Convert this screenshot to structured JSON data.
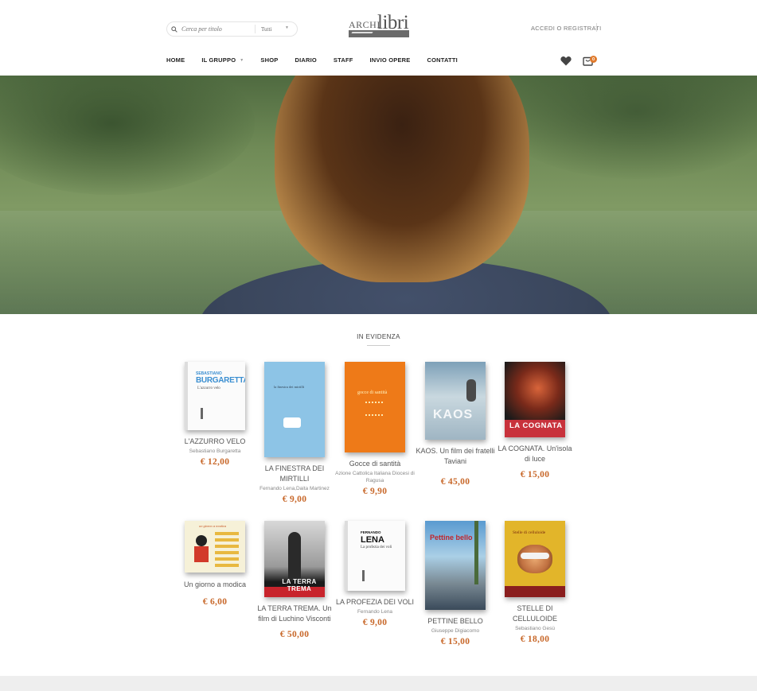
{
  "header": {
    "search": {
      "placeholder": "Cerca per titolo",
      "category": "Tutti"
    },
    "logo": {
      "part1": "ARCHI",
      "part2": "libri"
    },
    "login_label": "ACCEDI O REGISTRATI",
    "cart_count": "0"
  },
  "nav": [
    {
      "label": "HOME"
    },
    {
      "label": "IL GRUPPO"
    },
    {
      "label": "SHOP"
    },
    {
      "label": "DIARIO"
    },
    {
      "label": "STAFF"
    },
    {
      "label": "INVIO OPERE"
    },
    {
      "label": "CONTATTI"
    }
  ],
  "featured": {
    "title": "IN EVIDENZA",
    "books": [
      {
        "title": "L'AZZURRO VELO",
        "author": "Sebastiano Burgaretta",
        "price": "€ 12,00",
        "cover": {
          "top_author": "SEBASTIANO",
          "top_title": "BURGARETTA",
          "subtitle": "L'azzurro velo"
        }
      },
      {
        "title": "LA FINESTRA DEI MIRTILLI",
        "author": "Fernando Lena,Daita Martinez",
        "price": "€ 9,00",
        "cover": {
          "text": "la finestra dei mirtilli"
        }
      },
      {
        "title": "Gocce di santità",
        "author": "Azione Cattolica Italiana Diocesi di Ragusa",
        "price": "€ 9,90",
        "cover": {
          "text": "gocce di santità"
        }
      },
      {
        "title": "KAOS. Un film dei fratelli Taviani",
        "author": "",
        "price": "€ 45,00",
        "cover": {
          "text": "KAOS"
        }
      },
      {
        "title": "LA COGNATA. Un'isola di luce",
        "author": "",
        "price": "€ 15,00",
        "cover": {
          "text": "LA COGNATA"
        }
      },
      {
        "title": "Un giorno a modica",
        "author": "",
        "price": "€ 6,00",
        "cover": {
          "text": "un giorno a modica"
        }
      },
      {
        "title": "LA TERRA TREMA. Un film di Luchino Visconti",
        "author": "",
        "price": "€ 50,00",
        "cover": {
          "text": "LA TERRA TREMA"
        }
      },
      {
        "title": "LA PROFEZIA DEI VOLI",
        "author": "Fernando Lena",
        "price": "€ 9,00",
        "cover": {
          "top_author": "FERNANDO",
          "top_title": "LENA",
          "subtitle": "La profezia dei voli"
        }
      },
      {
        "title": "PETTINE BELLO",
        "author": "Giuseppe Digiacomo",
        "price": "€ 15,00",
        "cover": {
          "text": "Pettine bello"
        }
      },
      {
        "title": "STELLE DI CELLULOIDE",
        "author": "Sebastiano Gesù",
        "price": "€ 18,00",
        "cover": {
          "text": "Stelle di celluloide"
        }
      }
    ]
  },
  "colors": {
    "accent": "#c8682a",
    "badge": "#e07a2c"
  }
}
